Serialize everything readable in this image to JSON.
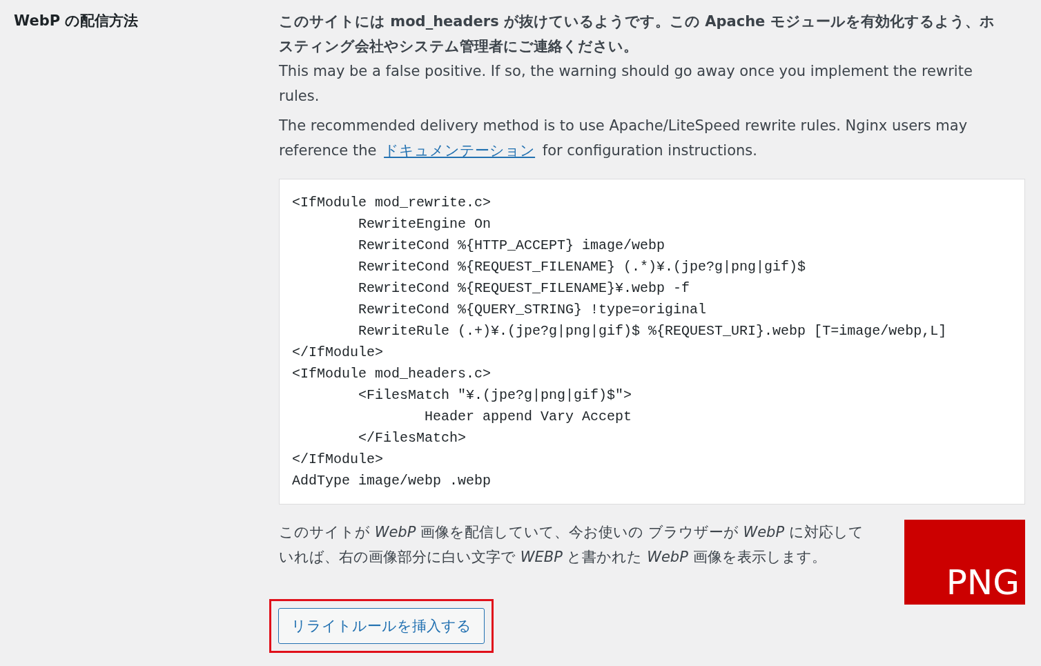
{
  "setting": {
    "label": "WebP の配信方法"
  },
  "warning": {
    "title": "このサイトには mod_headers が抜けているようです。この Apache モジュールを有効化するよう、ホスティング会社やシステム管理者にご連絡ください。",
    "note": "This may be a false positive. If so, the warning should go away once you implement the rewrite rules."
  },
  "recommendation": {
    "before": "The recommended delivery method is to use Apache/LiteSpeed rewrite rules. Nginx users may reference the ",
    "link": "ドキュメンテーション",
    "after": " for configuration instructions."
  },
  "code": "<IfModule mod_rewrite.c>\n\tRewriteEngine On\n\tRewriteCond %{HTTP_ACCEPT} image/webp\n\tRewriteCond %{REQUEST_FILENAME} (.*)¥.(jpe?g|png|gif)$\n\tRewriteCond %{REQUEST_FILENAME}¥.webp -f\n\tRewriteCond %{QUERY_STRING} !type=original\n\tRewriteRule (.+)¥.(jpe?g|png|gif)$ %{REQUEST_URI}.webp [T=image/webp,L]\n</IfModule>\n<IfModule mod_headers.c>\n\t<FilesMatch \"¥.(jpe?g|png|gif)$\">\n\t\tHeader append Vary Accept\n\t</FilesMatch>\n</IfModule>\nAddType image/webp .webp",
  "test": {
    "text": "このサイトが *WebP* 画像を配信していて、今お使いの ブラウザーが *WebP* に対応していれば、右の画像部分に白い文字で *WEBP* と書かれた *WebP* 画像を表示します。",
    "image_label": "PNG"
  },
  "button": {
    "label": "リライトルールを挿入する",
    "highlighted": true
  }
}
